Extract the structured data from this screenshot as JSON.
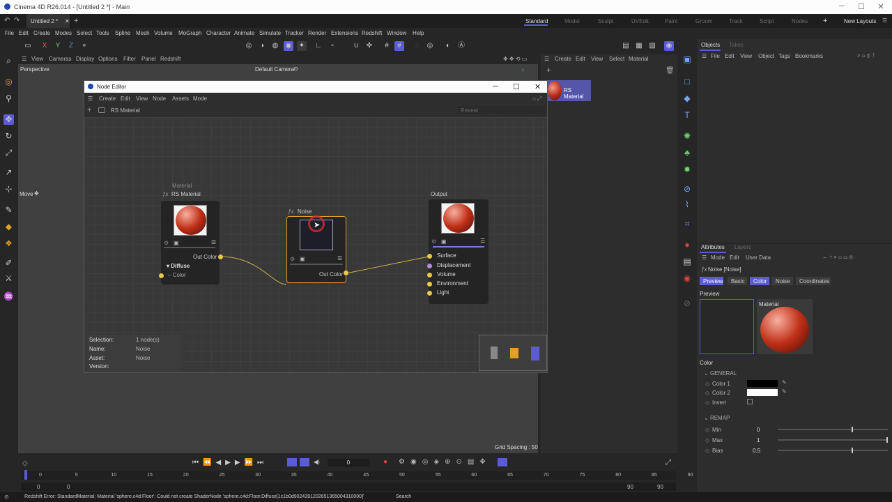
{
  "app": {
    "title": "Cinema 4D R26.014 - [Untitled 2 *] - Main",
    "doc_tab": "Untitled 2 *"
  },
  "layouts": [
    {
      "label": "Standard",
      "active": true
    },
    {
      "label": "Model"
    },
    {
      "label": "Sculpt"
    },
    {
      "label": "UVEdit"
    },
    {
      "label": "Paint"
    },
    {
      "label": "Groom"
    },
    {
      "label": "Track"
    },
    {
      "label": "Script"
    },
    {
      "label": "Nodes"
    }
  ],
  "new_layouts": "New Layouts",
  "menu": [
    "File",
    "Edit",
    "Create",
    "Modes",
    "Select",
    "Tools",
    "Spline",
    "Mesh",
    "Volume",
    "MoGraph",
    "Character",
    "Animate",
    "Simulate",
    "Tracker",
    "Render",
    "Extensions",
    "Redshift",
    "Window",
    "Help"
  ],
  "coord_axes": [
    "X",
    "Y",
    "Z"
  ],
  "viewport": {
    "menu": [
      "View",
      "Cameras",
      "Display",
      "Options",
      "Filter",
      "Panel",
      "Redshift"
    ],
    "label": "Perspective",
    "camera": "Default Camera",
    "camera_icon": "⊙",
    "tool": "Move",
    "tool_icon": "✥",
    "grid_spacing": "Grid Spacing : 50"
  },
  "material_panel": {
    "menu": [
      "Create",
      "Edit",
      "View",
      "Select",
      "Material"
    ],
    "material": "RS Material"
  },
  "objects": {
    "tabs": [
      "Objects",
      "Takes"
    ],
    "menu": [
      "File",
      "Edit",
      "View",
      "Object",
      "Tags",
      "Bookmarks"
    ]
  },
  "attributes": {
    "tabs": [
      "Attributes",
      "Layers"
    ],
    "menu": [
      "Mode",
      "Edit",
      "User Data"
    ],
    "object": "Noise [Noise]",
    "fx": "ƒx",
    "subtabs": [
      {
        "label": "Preview",
        "active": true
      },
      {
        "label": "Basic"
      },
      {
        "label": "Color",
        "active": true
      },
      {
        "label": "Noise"
      },
      {
        "label": "Coordinates"
      }
    ],
    "preview_heading": "Preview",
    "preview_material": "Material",
    "section": "Color",
    "general": "GENERAL",
    "color1": "Color 1",
    "color2": "Color 2",
    "invert": "Invert",
    "remap": "REMAP",
    "min": {
      "label": "Min",
      "value": "0",
      "fraction": 0.68
    },
    "max": {
      "label": "Max",
      "value": "1",
      "fraction": 1.0
    },
    "bias": {
      "label": "Bias",
      "value": "0.5",
      "fraction": 0.68
    }
  },
  "node_editor": {
    "title": "Node Editor",
    "menu": [
      "Create",
      "Edit",
      "View",
      "Node",
      "Assets",
      "Mode"
    ],
    "breadcrumb": "RS Material",
    "reveal": "Reveal",
    "nodes": {
      "material": {
        "category": "Material",
        "fx": "ƒx",
        "title": "RS Material",
        "out": "Out Color",
        "group": "Diffuse",
        "input": "Color"
      },
      "noise": {
        "fx": "ƒx",
        "title": "Noise",
        "out": "Out Color"
      },
      "output": {
        "title": "Output",
        "inputs": [
          "Surface",
          "Displacement",
          "Volume",
          "Environment",
          "Light"
        ]
      }
    },
    "info": {
      "selection_label": "Selection:",
      "selection": "1 node(s)",
      "name_label": "Name:",
      "name": "Noise",
      "asset_label": "Asset:",
      "asset": "Noise",
      "version_label": "Version:",
      "version": ""
    }
  },
  "timeline": {
    "frame": "0",
    "ticks": [
      "0",
      "5",
      "10",
      "15",
      "20",
      "25",
      "30",
      "35",
      "40",
      "45",
      "50",
      "55",
      "60",
      "65",
      "70",
      "75",
      "80",
      "85",
      "90"
    ],
    "start": "0",
    "start2": "0",
    "end": "90",
    "end2": "90"
  },
  "status": {
    "message": "Redshift Error: StandardMaterial: Material 'sphere.c4d:Floor': Could not create ShaderNode 'sphere.c4d:Floor.Diffuse[1c1b0d9024391202651365004310000]'",
    "search": "Search"
  },
  "colors": {
    "accent": "#5b5bd6",
    "selected_node": "#e0a02a",
    "port_yellow": "#e6c84a"
  }
}
